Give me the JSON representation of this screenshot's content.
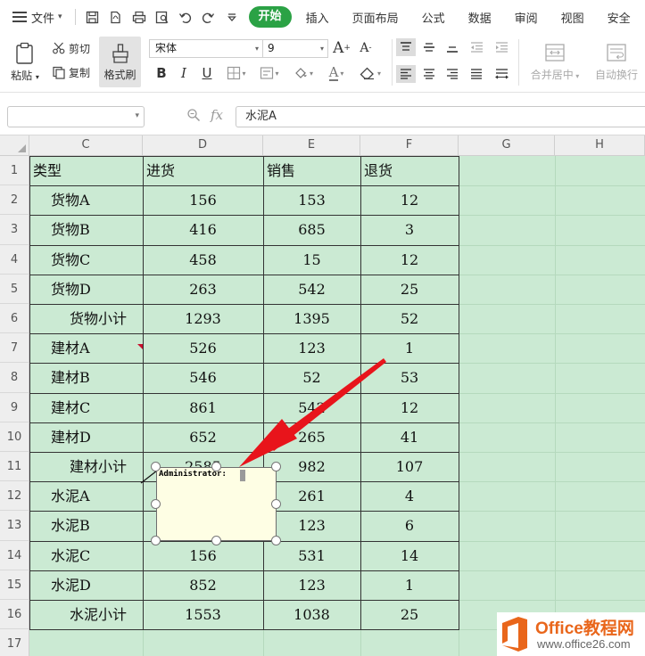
{
  "menubar": {
    "file_label": "文件",
    "tabs": [
      {
        "label": "开始",
        "active": true
      },
      {
        "label": "插入"
      },
      {
        "label": "页面布局"
      },
      {
        "label": "公式"
      },
      {
        "label": "数据"
      },
      {
        "label": "审阅"
      },
      {
        "label": "视图"
      },
      {
        "label": "安全"
      }
    ]
  },
  "ribbon": {
    "paste_label": "粘贴",
    "cut_label": "剪切",
    "copy_label": "复制",
    "format_painter_label": "格式刷",
    "font_name": "宋体",
    "font_size": "9",
    "merge_center_label": "合并居中",
    "auto_wrap_label": "自动换行",
    "accent_color": "#2ba245"
  },
  "formula_bar": {
    "name_box": "",
    "content": "水泥A"
  },
  "columns": [
    "C",
    "D",
    "E",
    "F",
    "G",
    "H"
  ],
  "rows": [
    "1",
    "2",
    "3",
    "4",
    "5",
    "6",
    "7",
    "8",
    "9",
    "10",
    "11",
    "12",
    "13",
    "14",
    "15",
    "16",
    "17"
  ],
  "table": {
    "headers": [
      "类型",
      "进货",
      "销售",
      "退货"
    ],
    "rows": [
      [
        "货物A",
        "156",
        "153",
        "12"
      ],
      [
        "货物B",
        "416",
        "685",
        "3"
      ],
      [
        "货物C",
        "458",
        "15",
        "12"
      ],
      [
        "货物D",
        "263",
        "542",
        "25"
      ],
      [
        "货物小计",
        "1293",
        "1395",
        "52"
      ],
      [
        "建材A",
        "526",
        "123",
        "1"
      ],
      [
        "建材B",
        "546",
        "52",
        "53"
      ],
      [
        "建材C",
        "861",
        "542",
        "12"
      ],
      [
        "建材D",
        "652",
        "265",
        "41"
      ],
      [
        "建材小计",
        "2585",
        "982",
        "107"
      ],
      [
        "水泥A",
        "",
        "261",
        "4"
      ],
      [
        "水泥B",
        "",
        "123",
        "6"
      ],
      [
        "水泥C",
        "156",
        "531",
        "14"
      ],
      [
        "水泥D",
        "852",
        "123",
        "1"
      ],
      [
        "水泥小计",
        "1553",
        "1038",
        "25"
      ]
    ]
  },
  "comment": {
    "author": "Administrator:"
  },
  "watermark": {
    "title": "Office教程网",
    "site": "www.office26.com"
  },
  "colors": {
    "grid_background": "#cbead3",
    "comment_background": "#fefee4",
    "arrow": "#e8141b",
    "watermark_orange": "#e9661b"
  }
}
